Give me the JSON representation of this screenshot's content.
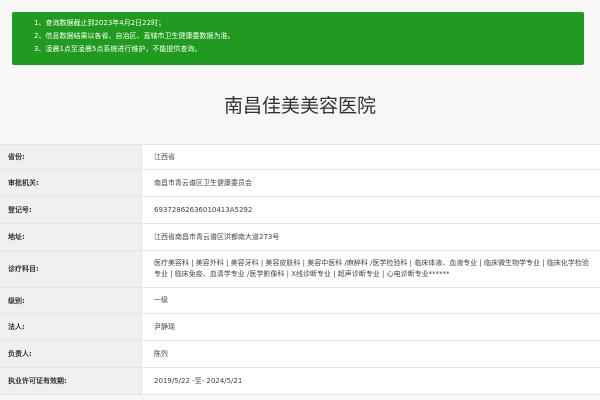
{
  "notice": {
    "lines": [
      "1、查询数据截止到2023年4月2日22时；",
      "2、信息数据结果以各省、自治区、直辖市卫生健康委数据为准。",
      "3、凌晨1点至凌晨5点系统进行维护，不能提供查询。"
    ]
  },
  "title": "南昌佳美美容医院",
  "rows": [
    {
      "label": "省份:",
      "value": "江西省"
    },
    {
      "label": "审批机关:",
      "value": "南昌市青云谱区卫生健康委员会"
    },
    {
      "label": "登记号:",
      "value": "69372862636010413A5292"
    },
    {
      "label": "地址:",
      "value": "江西省南昌市青云谱区洪都南大道273号"
    },
    {
      "label": "诊疗科目:",
      "value": "医疗美容科 | 美容外科 | 美容牙科 | 美容皮肤科 | 美容中医科 /麻醉科 /医学检验科 | 临床体液、血液专业 | 临床微生物学专业 | 临床化学检验专业 | 临床免疫、血清学专业 /医学影像科 | X线诊断专业 | 超声诊断专业 | 心电诊断专业******"
    },
    {
      "label": "级别:",
      "value": "一级"
    },
    {
      "label": "法人:",
      "value": "尹静瑶"
    },
    {
      "label": "负责人:",
      "value": "陈烈"
    },
    {
      "label": "执业许可证有效期:",
      "value": "2019/5/22 -至- 2024/5/21"
    }
  ]
}
